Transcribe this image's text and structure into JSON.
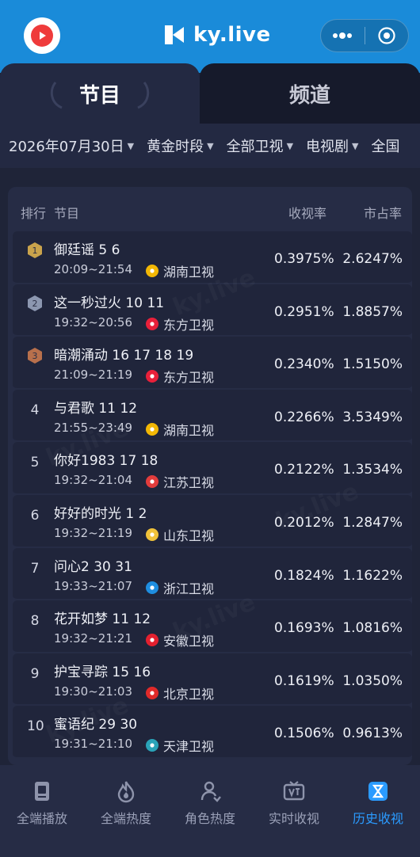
{
  "header": {
    "brand": "ky.live",
    "icons": [
      "app-logo-icon",
      "more-dots-icon",
      "close-target-icon"
    ]
  },
  "tabs": [
    {
      "label": "节目",
      "active": true
    },
    {
      "label": "频道",
      "active": false
    }
  ],
  "filters": [
    {
      "label": "2026年07月30日"
    },
    {
      "label": "黄金时段"
    },
    {
      "label": "全部卫视"
    },
    {
      "label": "电视剧"
    },
    {
      "label": "全国"
    }
  ],
  "table": {
    "headers": {
      "rank": "排行",
      "program": "节目",
      "rating": "收视率",
      "share": "市占率"
    },
    "rows": [
      {
        "rank": "1",
        "title": "御廷谣 5 6",
        "time": "20:09~21:54",
        "channel": "湖南卫视",
        "channel_color": "#f2b705",
        "rating": "0.3975%",
        "share": "2.6247%",
        "medal": "#c9a34c"
      },
      {
        "rank": "2",
        "title": "这一秒过火 10 11",
        "time": "19:32~20:56",
        "channel": "东方卫视",
        "channel_color": "#e8203a",
        "rating": "0.2951%",
        "share": "1.8857%",
        "medal": "#8c97b0"
      },
      {
        "rank": "3",
        "title": "暗潮涌动 16 17 18 19",
        "time": "21:09~21:19",
        "channel": "东方卫视",
        "channel_color": "#e8203a",
        "rating": "0.2340%",
        "share": "1.5150%",
        "medal": "#b8704c"
      },
      {
        "rank": "4",
        "title": "与君歌 11 12",
        "time": "21:55~23:49",
        "channel": "湖南卫视",
        "channel_color": "#f2b705",
        "rating": "0.2266%",
        "share": "3.5349%",
        "medal": ""
      },
      {
        "rank": "5",
        "title": "你好1983 17 18",
        "time": "19:32~21:04",
        "channel": "江苏卫视",
        "channel_color": "#e23c3c",
        "rating": "0.2122%",
        "share": "1.3534%",
        "medal": ""
      },
      {
        "rank": "6",
        "title": "好好的时光 1 2",
        "time": "19:32~21:19",
        "channel": "山东卫视",
        "channel_color": "#f0c23a",
        "rating": "0.2012%",
        "share": "1.2847%",
        "medal": ""
      },
      {
        "rank": "7",
        "title": "问心2 30 31",
        "time": "19:33~21:07",
        "channel": "浙江卫视",
        "channel_color": "#1e8ee0",
        "rating": "0.1824%",
        "share": "1.1622%",
        "medal": ""
      },
      {
        "rank": "8",
        "title": "花开如梦 11 12",
        "time": "19:32~21:21",
        "channel": "安徽卫视",
        "channel_color": "#e3202f",
        "rating": "0.1693%",
        "share": "1.0816%",
        "medal": ""
      },
      {
        "rank": "9",
        "title": "护宝寻踪 15 16",
        "time": "19:30~21:03",
        "channel": "北京卫视",
        "channel_color": "#e02a2a",
        "rating": "0.1619%",
        "share": "1.0350%",
        "medal": ""
      },
      {
        "rank": "10",
        "title": "蜜语纪 29 30",
        "time": "19:31~21:10",
        "channel": "天津卫视",
        "channel_color": "#2aa3b8",
        "rating": "0.1506%",
        "share": "0.9613%",
        "medal": ""
      }
    ]
  },
  "bottom_nav": [
    {
      "label": "全端播放",
      "icon": "phone-play-icon",
      "active": false
    },
    {
      "label": "全端热度",
      "icon": "flame-icon",
      "active": false
    },
    {
      "label": "角色热度",
      "icon": "person-icon",
      "active": false
    },
    {
      "label": "实时收视",
      "icon": "tv-icon",
      "active": false
    },
    {
      "label": "历史收视",
      "icon": "history-icon",
      "active": true
    }
  ],
  "colors": {
    "header_blue": "#1a8bd9",
    "background": "#1f2438",
    "active_nav": "#2b9bff"
  }
}
